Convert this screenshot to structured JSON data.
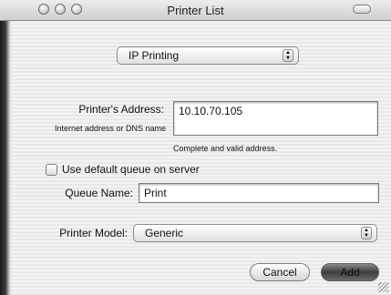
{
  "window": {
    "title": "Printer List"
  },
  "connection_popup": {
    "selected": "IP Printing"
  },
  "address": {
    "label": "Printer's Address:",
    "sublabel": "Internet address or DNS name",
    "value": "10.10.70.105",
    "status": "Complete and valid address."
  },
  "queue": {
    "checkbox_label": "Use default queue on server",
    "name_label": "Queue Name:",
    "name_value": "Print"
  },
  "model": {
    "label": "Printer Model:",
    "selected": "Generic"
  },
  "buttons": {
    "cancel": "Cancel",
    "add": "Add"
  }
}
